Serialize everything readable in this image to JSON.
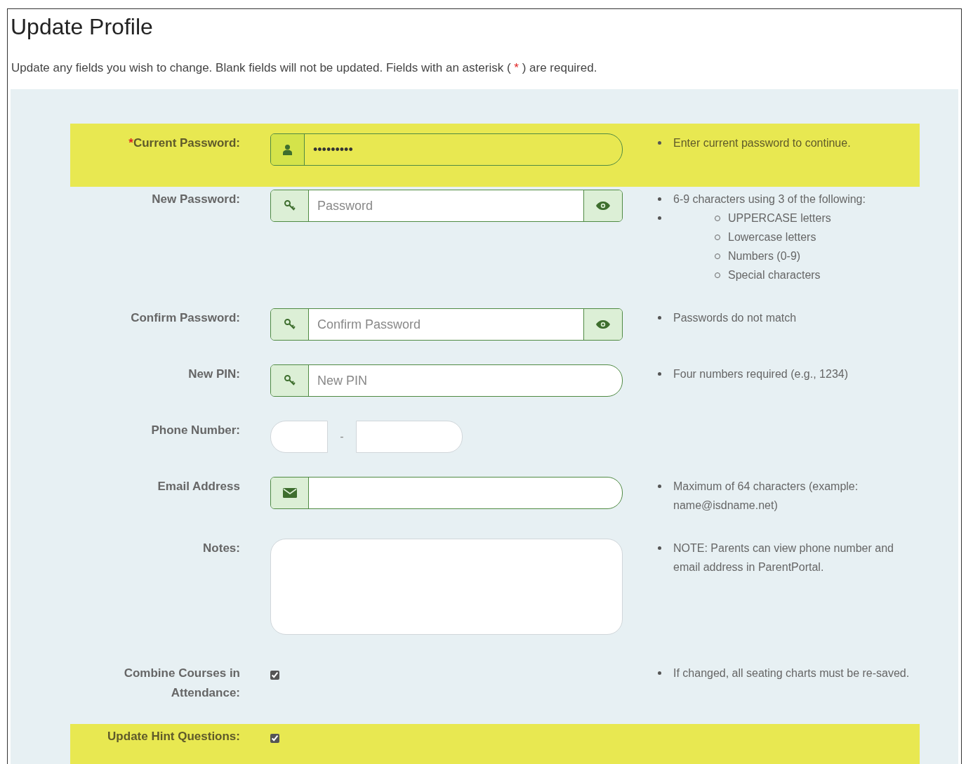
{
  "title": "Update Profile",
  "intro": {
    "before": "Update any fields you wish to change. Blank fields will not be updated. Fields with an asterisk (",
    "mark": "*",
    "after": ") are required."
  },
  "rows": [
    {
      "label": "Current Password:",
      "required": true,
      "highlighted": true,
      "kind": "account",
      "value": "•••••••••",
      "toggle": false,
      "hints": [
        {
          "text": "Enter current password to continue."
        }
      ]
    },
    {
      "label": "New Password:",
      "required": false,
      "highlighted": false,
      "kind": "password",
      "placeholder": "Password",
      "toggle": true,
      "hints": [
        {
          "text": "6-9 characters using 3 of the following:"
        },
        {
          "children": [
            "UPPERCASE letters",
            "Lowercase letters",
            "Numbers (0-9)",
            "Special characters"
          ]
        }
      ]
    },
    {
      "label": "Confirm Password:",
      "required": false,
      "highlighted": false,
      "kind": "password",
      "placeholder": "Confirm Password",
      "toggle": true,
      "hints": [
        {
          "text": "Passwords do not match"
        }
      ]
    },
    {
      "label": "New PIN:",
      "required": false,
      "highlighted": false,
      "kind": "password",
      "placeholder": "New PIN",
      "toggle": false,
      "hints": [
        {
          "text": "Four numbers required (e.g., 1234)"
        }
      ]
    },
    {
      "label": "Phone Number:",
      "required": false,
      "highlighted": false,
      "kind": "phone",
      "separator": "-"
    },
    {
      "label": "Email Address",
      "required": false,
      "highlighted": false,
      "kind": "email",
      "toggle": false,
      "hints": [
        {
          "text": "Maximum of 64 characters (example: name@isdname.net)"
        }
      ]
    },
    {
      "label": "Notes:",
      "required": false,
      "highlighted": false,
      "kind": "textarea",
      "hints": [
        {
          "text": "NOTE: Parents can view phone number and email address in ParentPortal."
        }
      ]
    },
    {
      "label": "Combine Courses in Attendance:",
      "required": false,
      "highlighted": false,
      "kind": "checkbox",
      "checked": true,
      "hints": [
        {
          "text": "If changed, all seating charts must be re-saved."
        }
      ]
    },
    {
      "label": "Update Hint Questions:",
      "required": false,
      "highlighted": true,
      "kind": "checkbox",
      "checked": true
    }
  ]
}
